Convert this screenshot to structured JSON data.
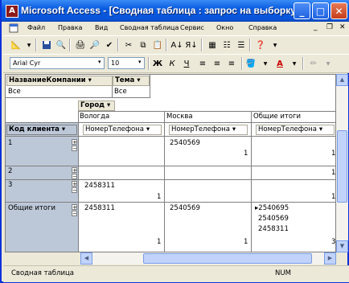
{
  "window": {
    "title": "Microsoft Access - [Сводная таблица : запрос на выборку]"
  },
  "menu": {
    "items": [
      "Файл",
      "Правка",
      "Вид",
      "Сводная таблица",
      "Сервис",
      "Окно",
      "Справка"
    ]
  },
  "toolbar2": {
    "font": "Arial Cyr",
    "size": "10",
    "bold": "Ж",
    "italic": "К",
    "underline": "Ч",
    "color_a": "A"
  },
  "filter": {
    "field1_label": "НазваниеКомпании",
    "field1_value": "Все",
    "field2_label": "Тема",
    "field2_value": "Все"
  },
  "pivot": {
    "column_field": "Город",
    "cities": [
      "Вологда",
      "Москва",
      "Общие итоги"
    ],
    "row_field": "Код клиента",
    "data_field_label": "НомерТелефона",
    "rows": [
      {
        "key": "1",
        "moscow_value": "2540569",
        "moscow_count": "1",
        "total_count": "1"
      },
      {
        "key": "2",
        "total_count": "1"
      },
      {
        "key": "3",
        "vologda_value": "2458311",
        "vologda_count": "1",
        "total_count": "1"
      },
      {
        "key": "Общие итоги",
        "vologda_value": "2458311",
        "vologda_count": "1",
        "moscow_value": "2540569",
        "moscow_count": "1",
        "total_values": [
          "2540695",
          "2540569",
          "2458311"
        ],
        "total_count": "3"
      }
    ]
  },
  "status": {
    "left": "Сводная таблица",
    "num": "NUM"
  },
  "colors": {
    "title": "#0a54d8",
    "row_header": "#bcc8d8"
  }
}
